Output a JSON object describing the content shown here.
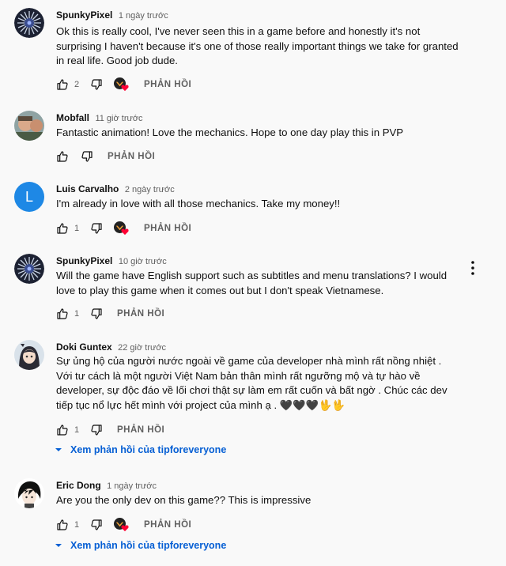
{
  "strings": {
    "reply_label": "PHẢN HỒI",
    "view_replies_label": "Xem phản hồi của tipforeveryone"
  },
  "colors": {
    "link_blue": "#065fd4",
    "heart_red": "#ff0033",
    "secondary_text": "#606060"
  },
  "comments": [
    {
      "author": "SpunkyPixel",
      "time": "1 ngày trước",
      "text": "Ok this is really cool, I've never seen this in a game before and honestly it's not surprising I haven't because it's one of those really important things we take for granted in real life. Good job dude.",
      "likes": "2",
      "avatar": "spunkypixel-avatar",
      "creator_heart": true
    },
    {
      "author": "Mobfall",
      "time": "11 giờ trước",
      "text": "Fantastic animation! Love the mechanics. Hope to one day play this in PVP",
      "likes": "",
      "avatar": "mobfall-avatar",
      "creator_heart": false
    },
    {
      "author": "Luis Carvalho",
      "time": "2 ngày trước",
      "text": "I'm already in love with all those mechanics. Take my money!!",
      "likes": "1",
      "avatar_letter": "L",
      "avatar_color": "#1e88e5",
      "creator_heart": true
    },
    {
      "author": "SpunkyPixel",
      "time": "10 giờ trước",
      "text": "Will the game have English support such as subtitles and menu translations? I would love to play this game when it comes out but I don't speak Vietnamese.",
      "likes": "1",
      "avatar": "spunkypixel-avatar",
      "creator_heart": false
    },
    {
      "author": "Doki Guntex",
      "time": "22 giờ trước",
      "text": "Sự ủng hộ của người nước ngoài về game của developer nhà mình rất nồng nhiệt . Với tư cách là một người Việt Nam bản thân mình rất ngưỡng mộ và tự hào về developer, sự độc đáo về lối chơi thật sự làm em rất cuốn và bất ngờ . Chúc các dev tiếp tục nổ lực hết mình với project của mình ạ . 🖤🖤🖤🖖🖖",
      "likes": "1",
      "avatar": "doki-avatar",
      "creator_heart": false
    },
    {
      "author": "Eric Dong",
      "time": "1 ngày trước",
      "text": "Are you the only dev on this game?? This is impressive",
      "likes": "1",
      "avatar": "eric-avatar",
      "creator_heart": true
    }
  ]
}
